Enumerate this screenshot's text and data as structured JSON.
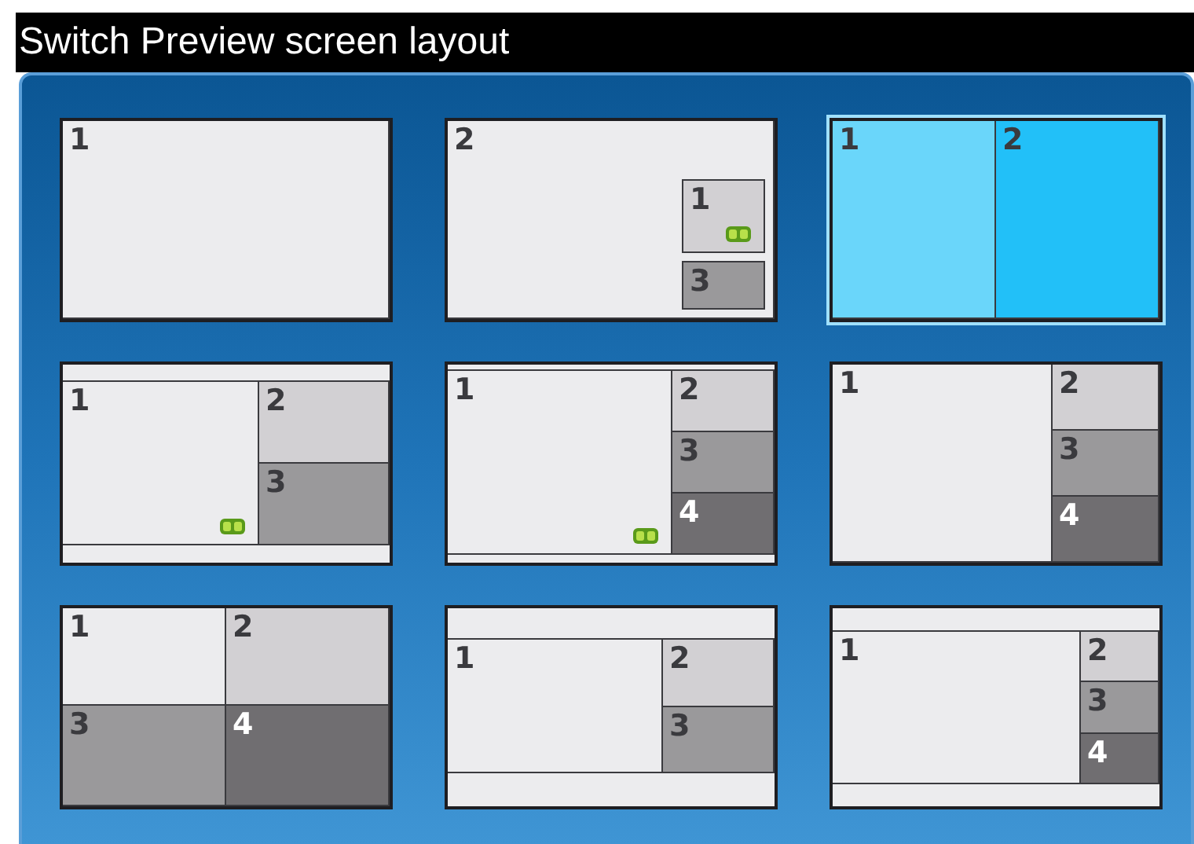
{
  "title": "Switch Preview screen layout",
  "layouts": [
    {
      "kind": "single",
      "selected": false,
      "panes": [
        {
          "label": "1",
          "color": "#ececee",
          "badge": false
        }
      ]
    },
    {
      "kind": "pip",
      "selected": false,
      "panes": [
        {
          "label": "2",
          "color": "#ececee",
          "badge": false
        },
        {
          "label": "1",
          "color": "#d2d0d3",
          "badge": true
        },
        {
          "label": "3",
          "color": "#9a999b",
          "badge": false
        }
      ]
    },
    {
      "kind": "halves",
      "selected": true,
      "panes": [
        {
          "label": "1",
          "color": "#6ad6fa",
          "badge": false
        },
        {
          "label": "2",
          "color": "#22c0f8",
          "badge": false
        }
      ]
    },
    {
      "kind": "bars-side2",
      "selected": false,
      "panes": [
        {
          "label": "1",
          "color": "#ececee",
          "badge": true
        },
        {
          "label": "2",
          "color": "#d2d0d3",
          "badge": false
        },
        {
          "label": "3",
          "color": "#9a999b",
          "badge": false
        }
      ]
    },
    {
      "kind": "thinbars-side3",
      "selected": false,
      "panes": [
        {
          "label": "1",
          "color": "#ececee",
          "badge": true
        },
        {
          "label": "2",
          "color": "#d2d0d3",
          "badge": false
        },
        {
          "label": "3",
          "color": "#9a999b",
          "badge": false
        },
        {
          "label": "4",
          "color": "#706e71",
          "badge": false
        }
      ]
    },
    {
      "kind": "side3",
      "selected": false,
      "panes": [
        {
          "label": "1",
          "color": "#ececee",
          "badge": false
        },
        {
          "label": "2",
          "color": "#d2d0d3",
          "badge": false
        },
        {
          "label": "3",
          "color": "#9a999b",
          "badge": false
        },
        {
          "label": "4",
          "color": "#706e71",
          "badge": false
        }
      ]
    },
    {
      "kind": "quad",
      "selected": false,
      "panes": [
        {
          "label": "1",
          "color": "#ececee",
          "badge": false
        },
        {
          "label": "2",
          "color": "#d2d0d3",
          "badge": false
        },
        {
          "label": "3",
          "color": "#9a999b",
          "badge": false
        },
        {
          "label": "4",
          "color": "#706e71",
          "badge": false
        }
      ]
    },
    {
      "kind": "widebars-side2",
      "selected": false,
      "panes": [
        {
          "label": "1",
          "color": "#ececee",
          "badge": false
        },
        {
          "label": "2",
          "color": "#d2d0d3",
          "badge": false
        },
        {
          "label": "3",
          "color": "#9a999b",
          "badge": false
        }
      ]
    },
    {
      "kind": "bars-side3narrow",
      "selected": false,
      "panes": [
        {
          "label": "1",
          "color": "#ececee",
          "badge": false
        },
        {
          "label": "2",
          "color": "#d2d0d3",
          "badge": false
        },
        {
          "label": "3",
          "color": "#9a999b",
          "badge": false
        },
        {
          "label": "4",
          "color": "#706e71",
          "badge": false
        }
      ]
    }
  ]
}
